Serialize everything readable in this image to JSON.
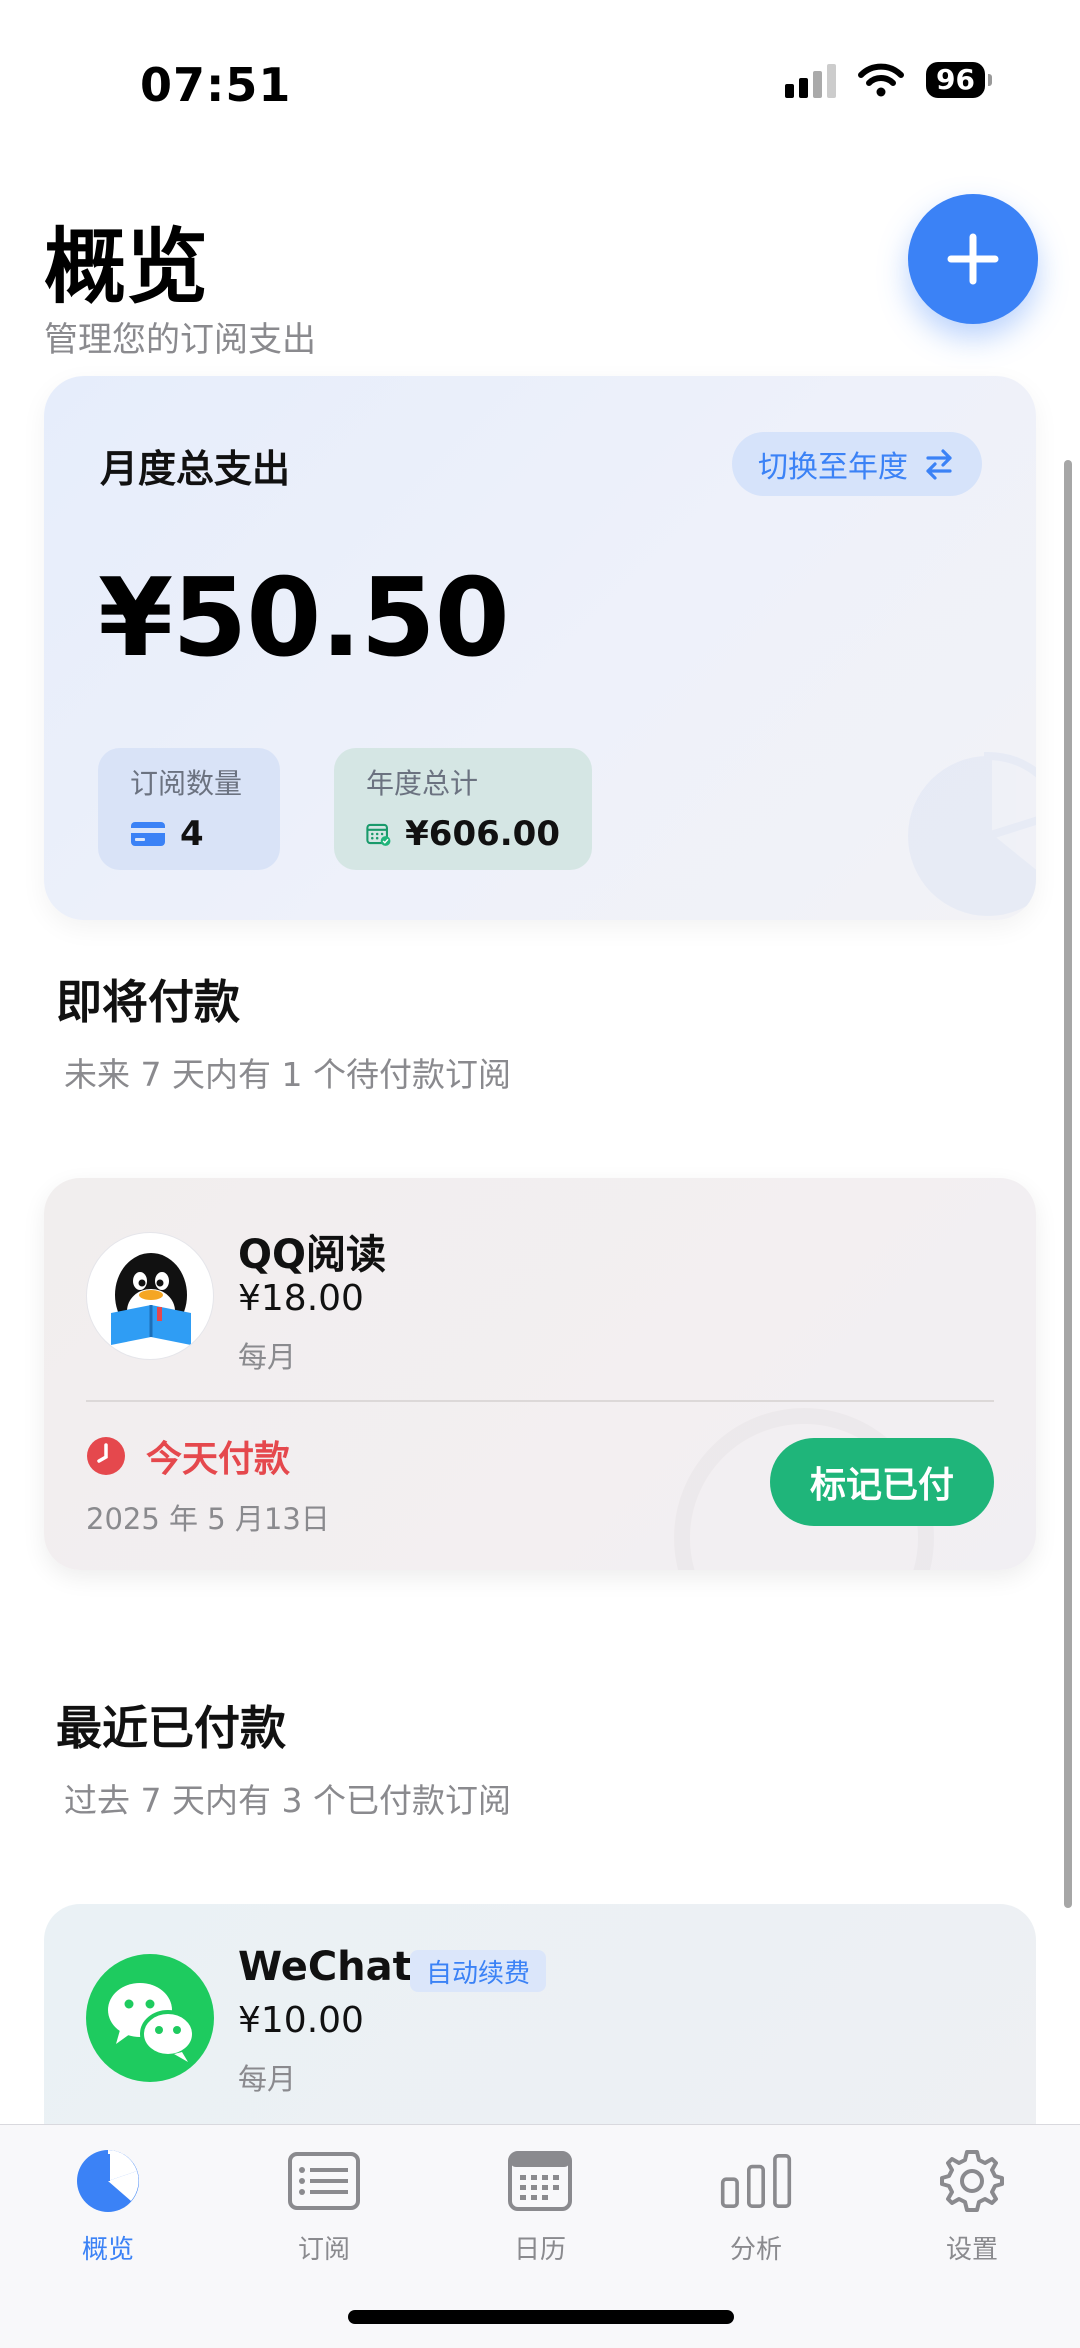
{
  "status_bar": {
    "time": "07:51",
    "battery": "96"
  },
  "header": {
    "title": "概览",
    "subtitle": "管理您的订阅支出"
  },
  "summary": {
    "label": "月度总支出",
    "switch_label": "切换至年度",
    "amount": "¥50.50",
    "count_label": "订阅数量",
    "count_value": "4",
    "yearly_label": "年度总计",
    "yearly_value": "¥606.00"
  },
  "upcoming": {
    "title": "即将付款",
    "subtitle": "未来 7 天内有 1 个待付款订阅",
    "items": [
      {
        "name": "QQ阅读",
        "price": "¥18.00",
        "cycle": "每月",
        "due_label": "今天付款",
        "due_date": "2025 年 5 月13日",
        "action": "标记已付"
      }
    ]
  },
  "recent": {
    "title": "最近已付款",
    "subtitle": "过去 7 天内有 3 个已付款订阅",
    "items": [
      {
        "name": "WeChat",
        "badge": "自动续费",
        "price": "¥10.00",
        "cycle": "每月"
      }
    ]
  },
  "tabs": [
    {
      "label": "概览",
      "icon": "pie-chart-icon",
      "active": true
    },
    {
      "label": "订阅",
      "icon": "list-icon",
      "active": false
    },
    {
      "label": "日历",
      "icon": "calendar-icon",
      "active": false
    },
    {
      "label": "分析",
      "icon": "bar-chart-icon",
      "active": false
    },
    {
      "label": "设置",
      "icon": "gear-icon",
      "active": false
    }
  ],
  "colors": {
    "accent": "#3b82f6",
    "success": "#1fb57a",
    "danger": "#e5484d"
  }
}
